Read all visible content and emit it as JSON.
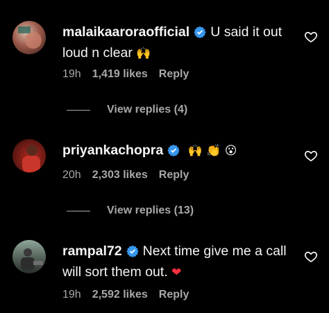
{
  "comments": [
    {
      "username": "malaikaaroraofficial",
      "text": "U said it out loud n clear",
      "emoji": "🙌",
      "time": "19h",
      "likes": "1,419 likes",
      "reply": "Reply",
      "view_replies": "View replies (4)"
    },
    {
      "username": "priyankachopra",
      "text": "",
      "emoji": "🙌 👏 😮",
      "time": "20h",
      "likes": "2,303 likes",
      "reply": "Reply",
      "view_replies": "View replies (13)"
    },
    {
      "username": "rampal72",
      "text": "Next time give me a call will sort them out.",
      "emoji": "❤",
      "time": "19h",
      "likes": "2,592 likes",
      "reply": "Reply"
    }
  ],
  "colors": {
    "background": "#000000",
    "text": "#f5f5f5",
    "muted": "#a8a8a8",
    "verified": "#3797f0",
    "heart_emoji": "#ff3040"
  },
  "icons": {
    "verified": "verified-badge-icon",
    "like": "heart-outline-icon"
  }
}
